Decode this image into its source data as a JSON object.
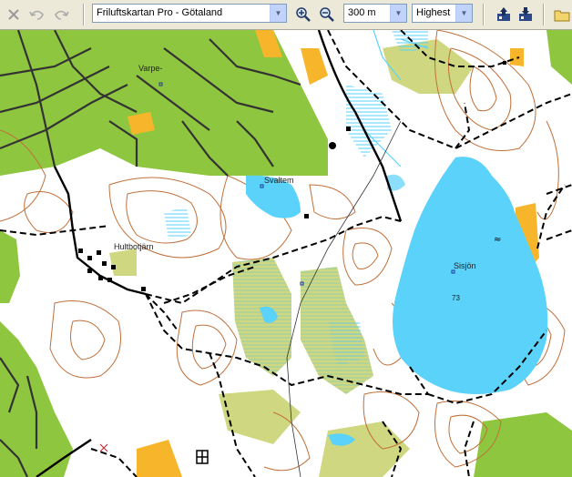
{
  "toolbar": {
    "map_select": "Friluftskartan Pro - Götaland",
    "scale_select": "300 m",
    "quality_select": "Highest"
  },
  "icons": [
    "close-icon",
    "undo-icon",
    "redo-icon",
    "zoom-in-icon",
    "zoom-out-icon",
    "upload-icon",
    "download-icon"
  ],
  "map": {
    "labels": {
      "varpe": "Varpe-",
      "svaltem": "Svaltem",
      "hultbotjarn": "Hultbotjärn",
      "sisjon": "Sisjön",
      "elevation": "73"
    },
    "colors": {
      "water": "#5ad2fa",
      "forest": "#8fc63f",
      "contour": "#c0703a",
      "road": "#000000",
      "open_land": "#f7b52b"
    }
  }
}
